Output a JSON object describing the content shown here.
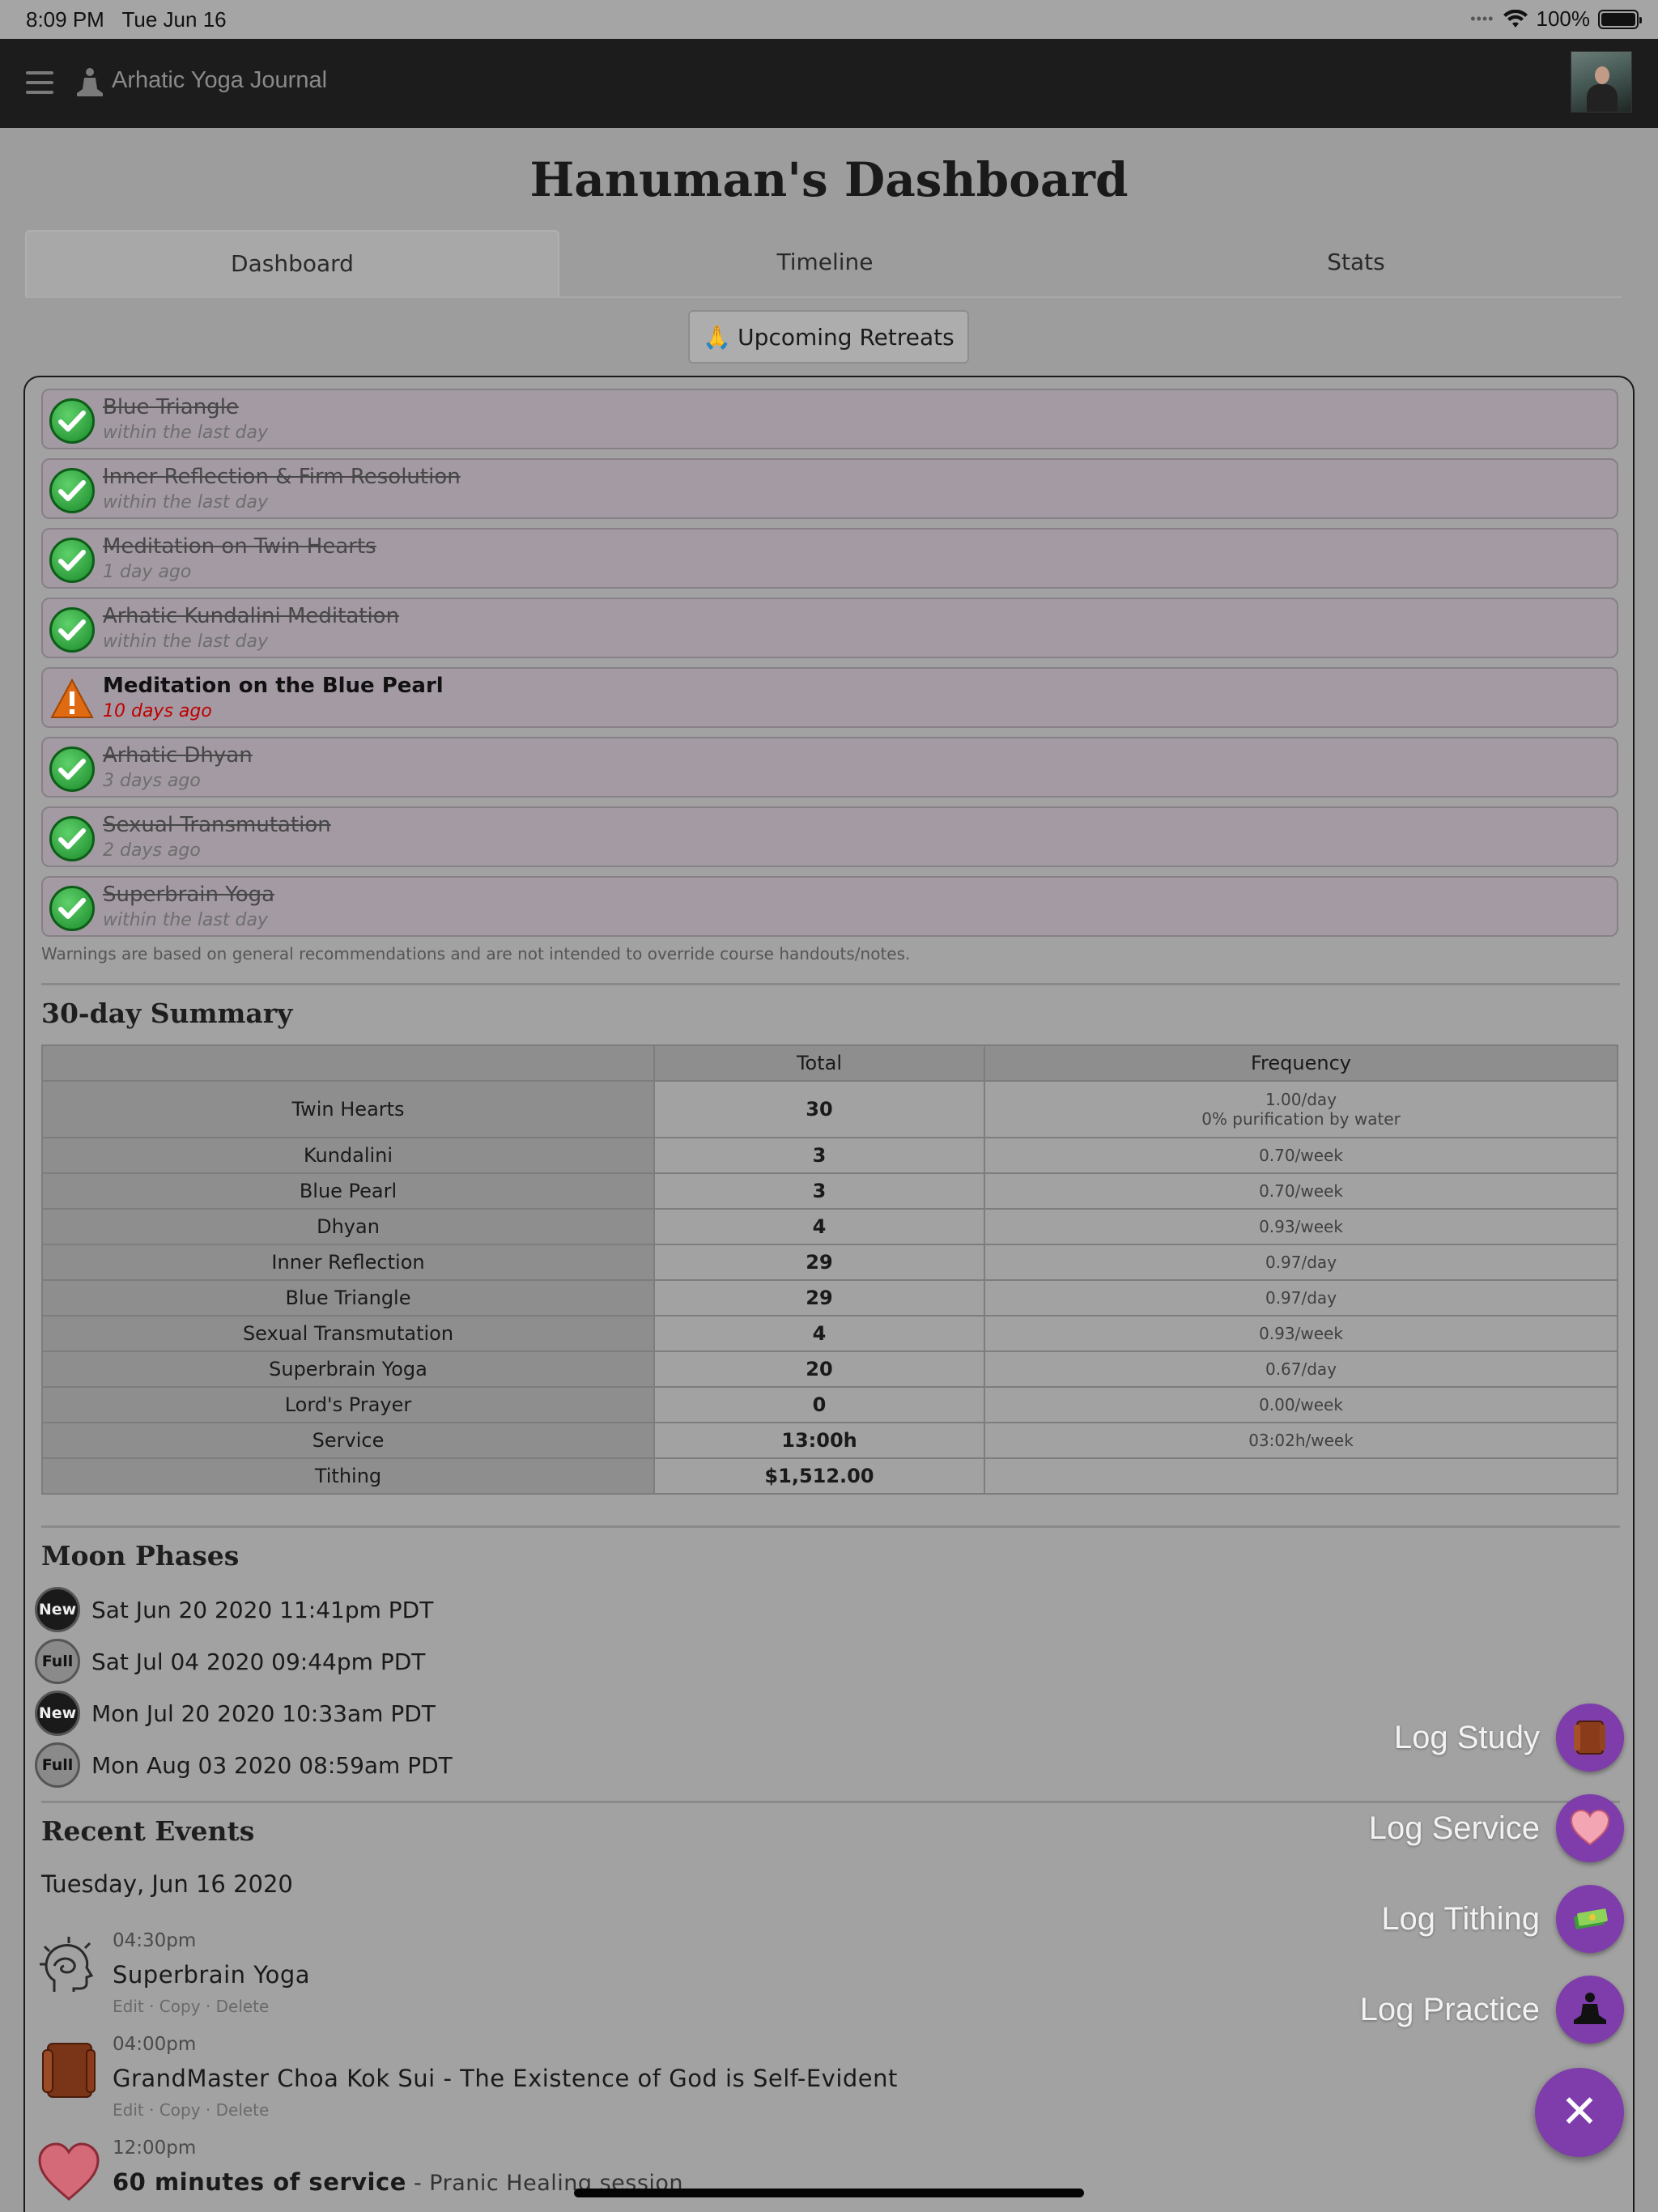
{
  "status": {
    "time": "8:09 PM",
    "date": "Tue Jun 16",
    "battery": "100%"
  },
  "app": {
    "title": "Arhatic Yoga Journal"
  },
  "page": {
    "title": "Hanuman's Dashboard"
  },
  "tabs": [
    {
      "label": "Dashboard",
      "active": true
    },
    {
      "label": "Timeline"
    },
    {
      "label": "Stats"
    }
  ],
  "retreats_button": {
    "emoji": "🙏",
    "label": "Upcoming Retreats"
  },
  "practices": [
    {
      "name": "Blue Triangle",
      "when": "within the last day",
      "status": "done"
    },
    {
      "name": "Inner Reflection & Firm Resolution",
      "when": "within the last day",
      "status": "done"
    },
    {
      "name": "Meditation on Twin Hearts",
      "when": "1 day ago",
      "status": "done"
    },
    {
      "name": "Arhatic Kundalini Meditation",
      "when": "within the last day",
      "status": "done"
    },
    {
      "name": "Meditation on the Blue Pearl",
      "when": "10 days ago",
      "status": "warning"
    },
    {
      "name": "Arhatic Dhyan",
      "when": "3 days ago",
      "status": "done"
    },
    {
      "name": "Sexual Transmutation",
      "when": "2 days ago",
      "status": "done"
    },
    {
      "name": "Superbrain Yoga",
      "when": "within the last day",
      "status": "done"
    }
  ],
  "warning_note": "Warnings are based on general recommendations and are not intended to override course handouts/notes.",
  "summary": {
    "title": "30-day Summary",
    "headers": [
      "",
      "Total",
      "Frequency"
    ],
    "rows": [
      {
        "label": "Twin Hearts",
        "total": "30",
        "freq": "1.00/day",
        "freq2": "0% purification by water"
      },
      {
        "label": "Kundalini",
        "total": "3",
        "freq": "0.70/week"
      },
      {
        "label": "Blue Pearl",
        "total": "3",
        "freq": "0.70/week"
      },
      {
        "label": "Dhyan",
        "total": "4",
        "freq": "0.93/week"
      },
      {
        "label": "Inner Reflection",
        "total": "29",
        "freq": "0.97/day"
      },
      {
        "label": "Blue Triangle",
        "total": "29",
        "freq": "0.97/day"
      },
      {
        "label": "Sexual Transmutation",
        "total": "4",
        "freq": "0.93/week"
      },
      {
        "label": "Superbrain Yoga",
        "total": "20",
        "freq": "0.67/day"
      },
      {
        "label": "Lord's Prayer",
        "total": "0",
        "freq": "0.00/week"
      },
      {
        "label": "Service",
        "total": "13:00h",
        "freq": "03:02h/week"
      },
      {
        "label": "Tithing",
        "total": "$1,512.00",
        "freq": ""
      }
    ]
  },
  "moon": {
    "title": "Moon Phases",
    "phases": [
      {
        "phase": "New",
        "date": "Sat Jun 20 2020 11:41pm PDT"
      },
      {
        "phase": "Full",
        "date": "Sat Jul 04 2020 09:44pm PDT"
      },
      {
        "phase": "New",
        "date": "Mon Jul 20 2020 10:33am PDT"
      },
      {
        "phase": "Full",
        "date": "Mon Aug 03 2020 08:59am PDT"
      }
    ]
  },
  "events": {
    "title": "Recent Events",
    "date": "Tuesday, Jun 16 2020",
    "items": [
      {
        "time": "04:30pm",
        "title": "Superbrain Yoga",
        "subtitle": "",
        "icon": "head-icon",
        "actions": "Edit · Copy · Delete"
      },
      {
        "time": "04:00pm",
        "title": "GrandMaster Choa Kok Sui - The Existence of God is Self-Evident",
        "subtitle": "",
        "icon": "book-icon",
        "actions": "Edit · Copy · Delete"
      },
      {
        "time": "12:00pm",
        "title": "60 minutes of service",
        "subtitle": " - Pranic Healing session",
        "icon": "heart-icon",
        "actions": ""
      }
    ]
  },
  "fab": {
    "items": [
      {
        "label": "Log Study",
        "icon": "book-icon"
      },
      {
        "label": "Log Service",
        "icon": "heart-icon"
      },
      {
        "label": "Log Tithing",
        "icon": "money-icon"
      },
      {
        "label": "Log Practice",
        "icon": "meditation-icon"
      }
    ],
    "close_symbol": "✕"
  },
  "colors": {
    "accent": "#7e3dab",
    "warning_text": "#c00000",
    "done_check": "#1a8a2a",
    "appbar": "#1c1c1c"
  }
}
